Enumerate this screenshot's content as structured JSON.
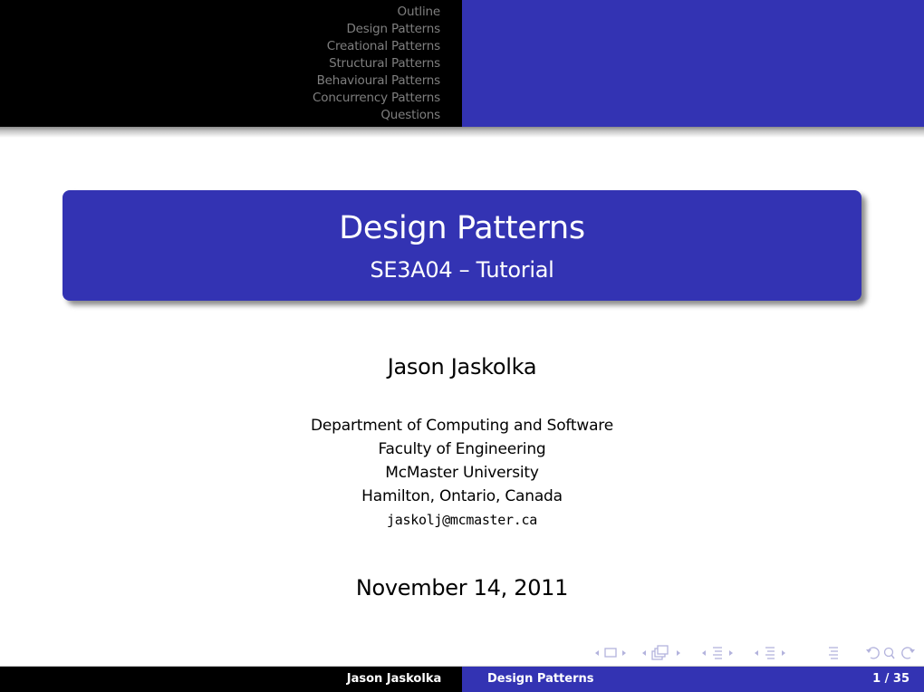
{
  "header": {
    "nav_sections": [
      "Outline",
      "Design Patterns",
      "Creational Patterns",
      "Structural Patterns",
      "Behavioural Patterns",
      "Concurrency Patterns",
      "Questions"
    ]
  },
  "title": {
    "main": "Design Patterns",
    "subtitle": "SE3A04 – Tutorial"
  },
  "author": "Jason Jaskolka",
  "institute": {
    "lines": [
      "Department of Computing and Software",
      "Faculty of Engineering",
      "McMaster University",
      "Hamilton, Ontario, Canada"
    ],
    "email": "jaskolj@mcmaster.ca"
  },
  "date": "November 14, 2011",
  "nav_symbols": [
    {
      "icon": "slide-nav-icon"
    },
    {
      "icon": "frame-nav-icon"
    },
    {
      "icon": "subsection-nav-icon"
    },
    {
      "icon": "section-nav-icon"
    },
    {
      "icon": "document-nav-icon"
    },
    {
      "icon": "back-search-forward-icon"
    }
  ],
  "footer": {
    "author": "Jason Jaskolka",
    "title": "Design Patterns",
    "page": "1 / 35"
  },
  "colors": {
    "primary": "#3333b3",
    "header_dark": "#000000",
    "nav_text": "#7f7f7f",
    "nav_symbols": "#b3b3dd"
  }
}
